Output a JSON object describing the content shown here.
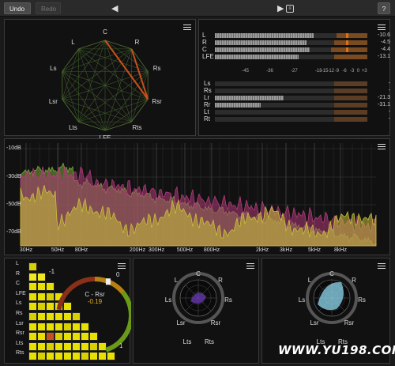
{
  "toolbar": {
    "undo_label": "Undo",
    "redo_label": "Redo",
    "help_label": "?",
    "prev_glyph": "◀",
    "next_glyph": "▶",
    "menu_glyph": "≡"
  },
  "speaker_map": {
    "channels": [
      "C",
      "R",
      "Rs",
      "Rsr",
      "Rts",
      "LFE",
      "Lts",
      "Lsr",
      "Ls",
      "L"
    ]
  },
  "level_meters": {
    "top_rows": [
      {
        "label": "L",
        "fill": 0.65,
        "hot": 0.2,
        "peak": true,
        "value": "-10.6"
      },
      {
        "label": "R",
        "fill": 0.6,
        "hot": 0.22,
        "peak": true,
        "value": "-4.5"
      },
      {
        "label": "C",
        "fill": 0.62,
        "hot": 0.24,
        "peak": true,
        "value": "-4.4"
      },
      {
        "label": "LFE",
        "fill": 0.55,
        "hot": 0.22,
        "peak": false,
        "value": "-13.1"
      }
    ],
    "scale": [
      "-45",
      "-36",
      "-27",
      "-18",
      "-15",
      "-12",
      "-9",
      "-6",
      "-3",
      "0",
      "+3"
    ],
    "bottom_rows": [
      {
        "label": "Ls",
        "fill": 0.0,
        "hot": 0.22,
        "value": "-"
      },
      {
        "label": "Rs",
        "fill": 0.0,
        "hot": 0.22,
        "value": "-"
      },
      {
        "label": "Lr",
        "fill": 0.45,
        "hot": 0.22,
        "value": "-21.3"
      },
      {
        "label": "Rr",
        "fill": 0.3,
        "hot": 0.22,
        "value": "-31.1"
      },
      {
        "label": "Lt",
        "fill": 0.0,
        "hot": 0.22,
        "value": "-"
      },
      {
        "label": "Rt",
        "fill": 0.0,
        "hot": 0.22,
        "value": "-"
      }
    ]
  },
  "spectrum": {
    "db_labels": [
      "-10dB",
      "-30dB",
      "-50dB",
      "-70dB"
    ],
    "freq_labels": [
      "30Hz",
      "50Hz",
      "80Hz",
      "200Hz",
      "300Hz",
      "500Hz",
      "800Hz",
      "2kHz",
      "3kHz",
      "5kHz",
      "8kHz"
    ]
  },
  "correlation": {
    "rows": [
      "L",
      "R",
      "C",
      "LFE",
      "Ls",
      "Rs",
      "Lsr",
      "Rsr",
      "Lts",
      "Rts"
    ],
    "pair_label": "C - Rsr",
    "pair_value": "-0.19",
    "gauge_min": "-1",
    "gauge_zero": "0",
    "gauge_max": "1"
  },
  "surround_scope_1": {
    "labels": [
      "L",
      "C",
      "R",
      "Ls",
      "Rs",
      "Lsr",
      "Rsr",
      "Lts",
      "Rts"
    ]
  },
  "surround_scope_2": {
    "labels": [
      "L",
      "C",
      "R",
      "Ls",
      "Rs",
      "Lsr",
      "Rsr",
      "Lts",
      "Rts"
    ]
  },
  "watermark": "WWW.YU198.COM"
}
